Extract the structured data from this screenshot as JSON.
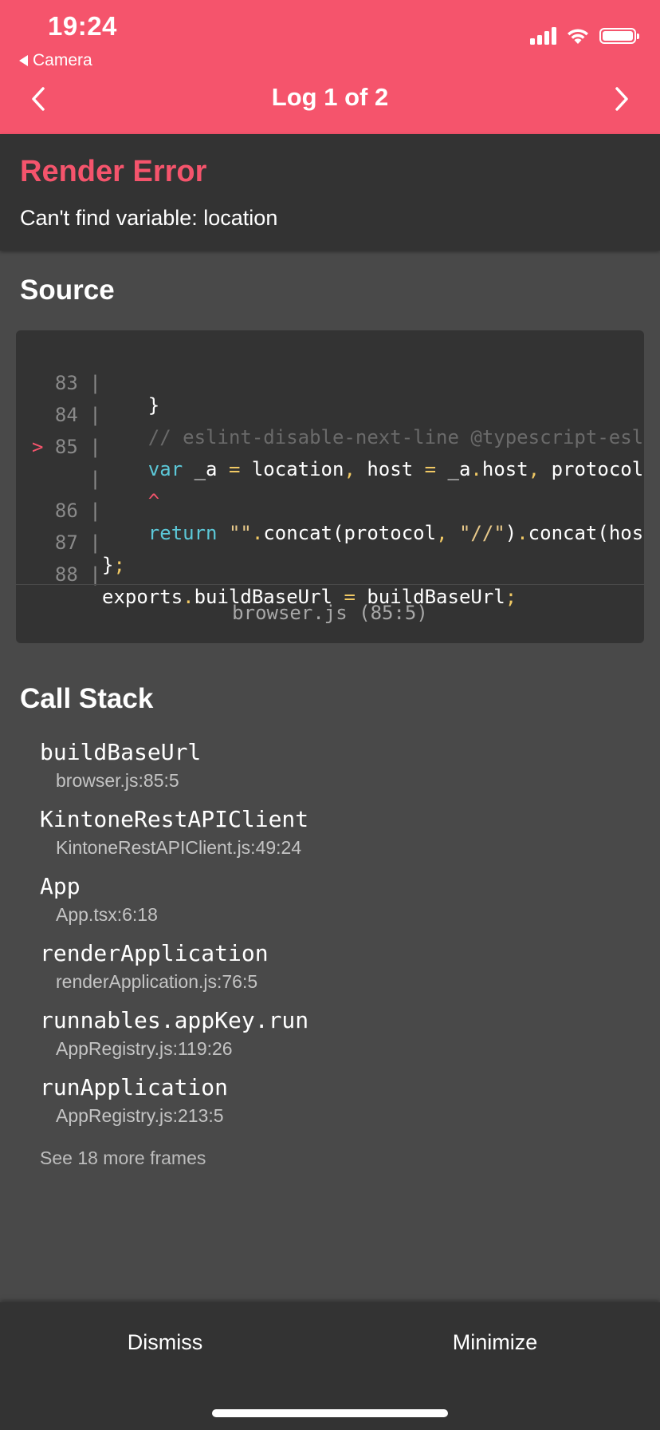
{
  "status_bar": {
    "time": "19:24",
    "back_app": "Camera",
    "icons": [
      "signal-icon",
      "wifi-icon",
      "battery-icon"
    ]
  },
  "header": {
    "title": "Log 1 of 2",
    "prev_icon": "chevron-left-icon",
    "next_icon": "chevron-right-icon",
    "background": "#F5546C"
  },
  "error": {
    "title": "Render Error",
    "message": "Can't find variable: location"
  },
  "source": {
    "title": "Source",
    "lines": [
      {
        "gutter": "  83 |",
        "code": "    }"
      },
      {
        "gutter": "  84 |",
        "code": "    // eslint-disable-next-line @typescript-eslint"
      },
      {
        "gutter": "> 85 |",
        "code": "    var _a = location, host = _a.host, protocol"
      },
      {
        "gutter": "     |",
        "code": "    ^"
      },
      {
        "gutter": "  86 |",
        "code": "    return \"\".concat(protocol, \"//\").concat(host"
      },
      {
        "gutter": "  87 |",
        "code": "};"
      },
      {
        "gutter": "  88 |",
        "code": "exports.buildBaseUrl = buildBaseUrl;"
      }
    ],
    "file": "browser.js (85:5)"
  },
  "call_stack": {
    "title": "Call Stack",
    "frames": [
      {
        "fn": "buildBaseUrl",
        "loc": "browser.js:85:5"
      },
      {
        "fn": "KintoneRestAPIClient",
        "loc": "KintoneRestAPIClient.js:49:24"
      },
      {
        "fn": "App",
        "loc": "App.tsx:6:18"
      },
      {
        "fn": "renderApplication",
        "loc": "renderApplication.js:76:5"
      },
      {
        "fn": "runnables.appKey.run",
        "loc": "AppRegistry.js:119:26"
      },
      {
        "fn": "runApplication",
        "loc": "AppRegistry.js:213:5"
      }
    ],
    "see_more": "See 18 more frames"
  },
  "footer": {
    "dismiss": "Dismiss",
    "minimize": "Minimize"
  }
}
